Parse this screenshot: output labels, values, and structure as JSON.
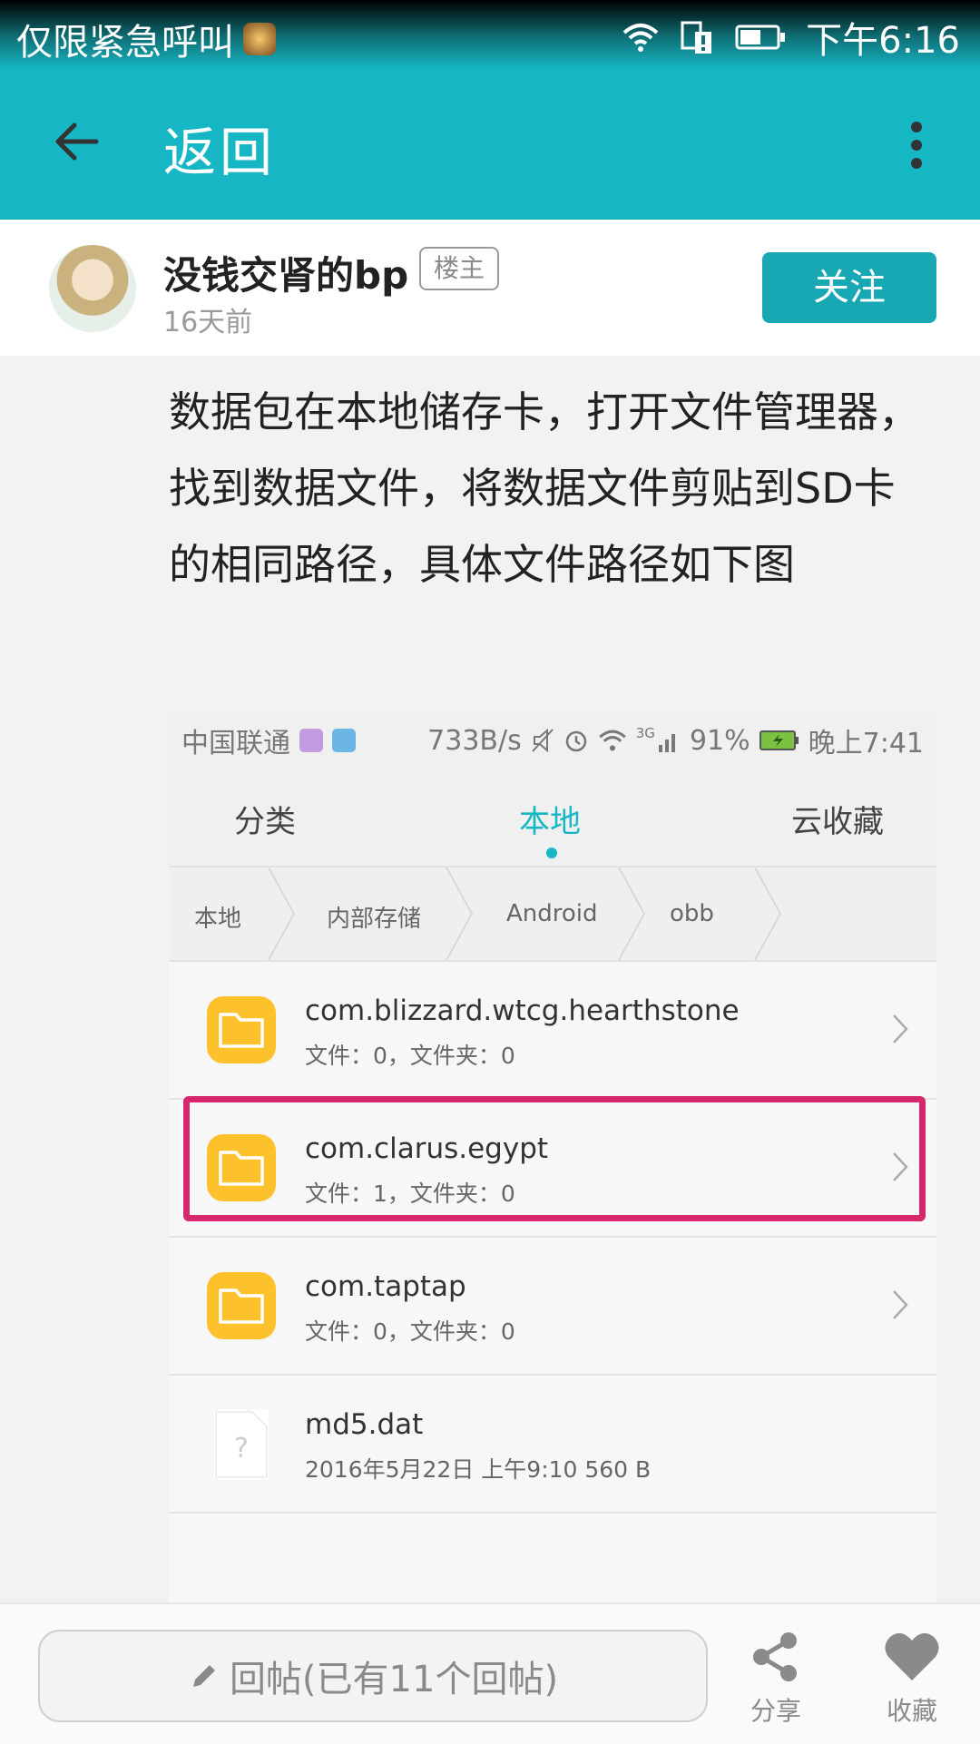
{
  "status_bar": {
    "carrier": "仅限紧急呼叫",
    "time": "下午6:16"
  },
  "app_bar": {
    "title": "返回"
  },
  "author": {
    "name": "没钱交肾的bp",
    "badge": "楼主",
    "time": "16天前",
    "follow_label": "关注"
  },
  "post": {
    "text": "数据包在本地储存卡，打开文件管理器，找到数据文件，将数据文件剪贴到SD卡的相同路径，具体文件路径如下图"
  },
  "screenshot": {
    "status": {
      "carrier": "中国联通",
      "speed": "733B/s",
      "network": "3G",
      "battery": "91%",
      "time": "晚上7:41"
    },
    "tabs": [
      "分类",
      "本地",
      "云收藏"
    ],
    "active_tab": "本地",
    "breadcrumbs": [
      "本地",
      "内部存储",
      "Android",
      "obb"
    ],
    "files": [
      {
        "name": "com.blizzard.wtcg.hearthstone",
        "meta": "文件：0，文件夹：0",
        "type": "folder"
      },
      {
        "name": "com.clarus.egypt",
        "meta": "文件：1，文件夹：0",
        "type": "folder",
        "highlighted": true
      },
      {
        "name": "com.taptap",
        "meta": "文件：0，文件夹：0",
        "type": "folder"
      },
      {
        "name": "md5.dat",
        "meta": "2016年5月22日 上午9:10 560 B",
        "type": "file"
      }
    ],
    "colors": {
      "accent": "#17b6c4",
      "folder": "#fdc12b",
      "highlight": "#d6266c"
    }
  },
  "bottom_bar": {
    "reply_label": "回帖(已有11个回帖)",
    "share_label": "分享",
    "favorite_label": "收藏"
  },
  "colors": {
    "accent": "#17b6c4",
    "follow_button": "#17a8b4"
  }
}
